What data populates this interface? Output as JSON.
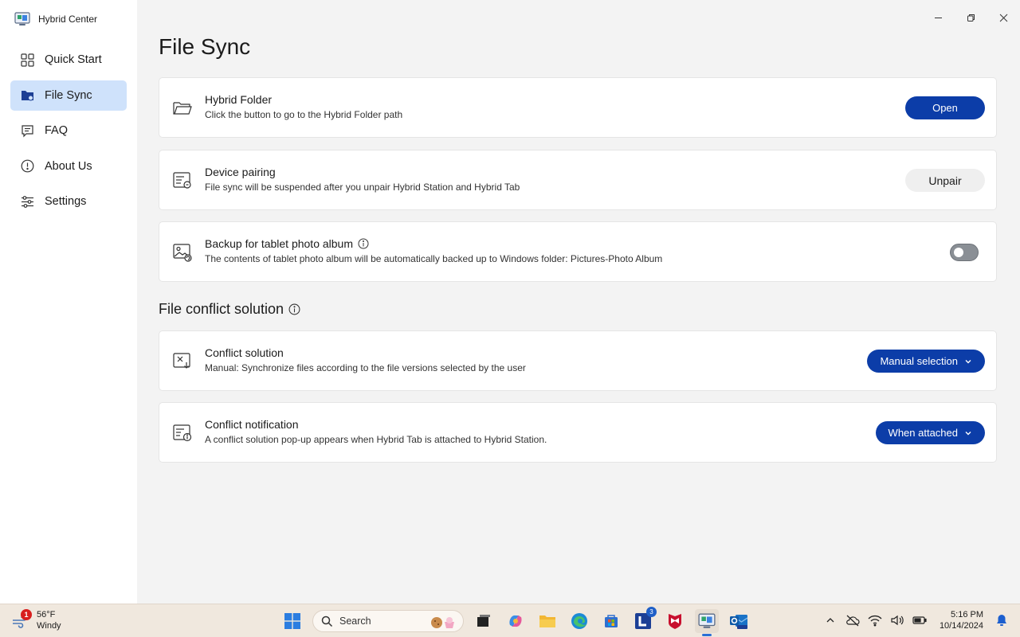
{
  "app": {
    "title": "Hybrid Center"
  },
  "sidebar": {
    "items": [
      {
        "label": "Quick Start",
        "icon": "grid-icon"
      },
      {
        "label": "File Sync",
        "icon": "file-sync-icon",
        "active": true
      },
      {
        "label": "FAQ",
        "icon": "chat-icon"
      },
      {
        "label": "About Us",
        "icon": "info-circle-icon"
      },
      {
        "label": "Settings",
        "icon": "sliders-icon"
      }
    ]
  },
  "main": {
    "title": "File Sync",
    "cards": {
      "hybrid_folder": {
        "title": "Hybrid Folder",
        "desc": "Click the button to go to the Hybrid Folder path",
        "button": "Open"
      },
      "device_pairing": {
        "title": "Device pairing",
        "desc": "File sync will be suspended after you unpair Hybrid Station and Hybrid Tab",
        "button": "Unpair"
      },
      "backup": {
        "title": "Backup for tablet photo album",
        "desc": "The contents of tablet photo album will be automatically backed up to Windows folder: Pictures-Photo Album",
        "toggle_on": false
      }
    },
    "section": {
      "title": "File conflict solution"
    },
    "conflict": {
      "solution": {
        "title": "Conflict solution",
        "desc": "Manual: Synchronize files according to the file versions selected by the user",
        "value": "Manual selection"
      },
      "notification": {
        "title": "Conflict notification",
        "desc": "A conflict solution pop-up appears when Hybrid Tab is attached to Hybrid Station.",
        "value": "When attached"
      }
    }
  },
  "taskbar": {
    "weather": {
      "temp": "56°F",
      "condition": "Windy",
      "badge": "1"
    },
    "search_placeholder": "Search",
    "lenovo_badge": "3",
    "clock": {
      "time": "5:16 PM",
      "date": "10/14/2024"
    }
  },
  "colors": {
    "accent": "#0c3da8",
    "active_nav": "#cfe2fb"
  }
}
